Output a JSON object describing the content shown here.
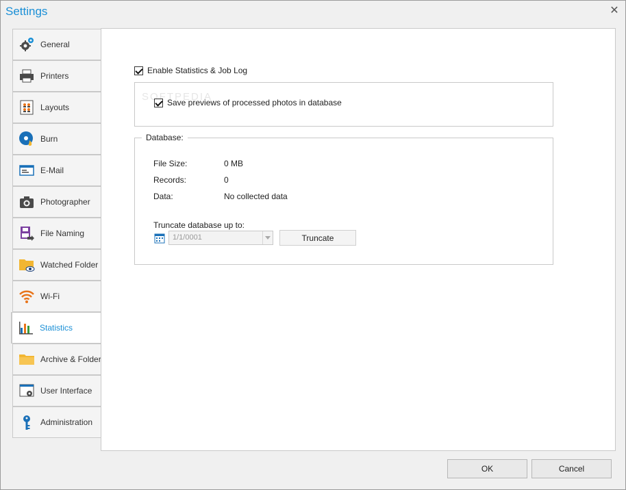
{
  "window": {
    "title": "Settings"
  },
  "sidebar": {
    "items": [
      {
        "label": "General",
        "icon": "gear-icon"
      },
      {
        "label": "Printers",
        "icon": "printer-icon"
      },
      {
        "label": "Layouts",
        "icon": "layouts-icon"
      },
      {
        "label": "Burn",
        "icon": "disc-burn-icon"
      },
      {
        "label": "E-Mail",
        "icon": "email-icon"
      },
      {
        "label": "Photographer",
        "icon": "camera-icon"
      },
      {
        "label": "File Naming",
        "icon": "file-naming-icon"
      },
      {
        "label": "Watched Folder",
        "icon": "watched-folder-icon"
      },
      {
        "label": "Wi-Fi",
        "icon": "wifi-icon"
      },
      {
        "label": "Statistics",
        "icon": "bar-chart-icon",
        "active": true
      },
      {
        "label": "Archive & Folders",
        "icon": "folder-icon"
      },
      {
        "label": "User Interface",
        "icon": "user-interface-icon"
      },
      {
        "label": "Administration",
        "icon": "key-icon"
      }
    ]
  },
  "statistics": {
    "enable_label": "Enable Statistics & Job Log",
    "enable_checked": true,
    "save_previews_label": "Save previews of processed photos in database",
    "save_previews_checked": true,
    "watermark": "SOFTPEDIA",
    "database": {
      "legend": "Database:",
      "file_size_label": "File Size:",
      "file_size_value": "0 MB",
      "records_label": "Records:",
      "records_value": "0",
      "data_label": "Data:",
      "data_value": "No collected data",
      "truncate_label": "Truncate database up to:",
      "truncate_date": "1/1/0001",
      "truncate_button": "Truncate"
    }
  },
  "footer": {
    "ok_label": "OK",
    "cancel_label": "Cancel"
  },
  "colors": {
    "accent": "#1a8fd6",
    "wifi": "#e8741a",
    "folder": "#f2b632"
  }
}
